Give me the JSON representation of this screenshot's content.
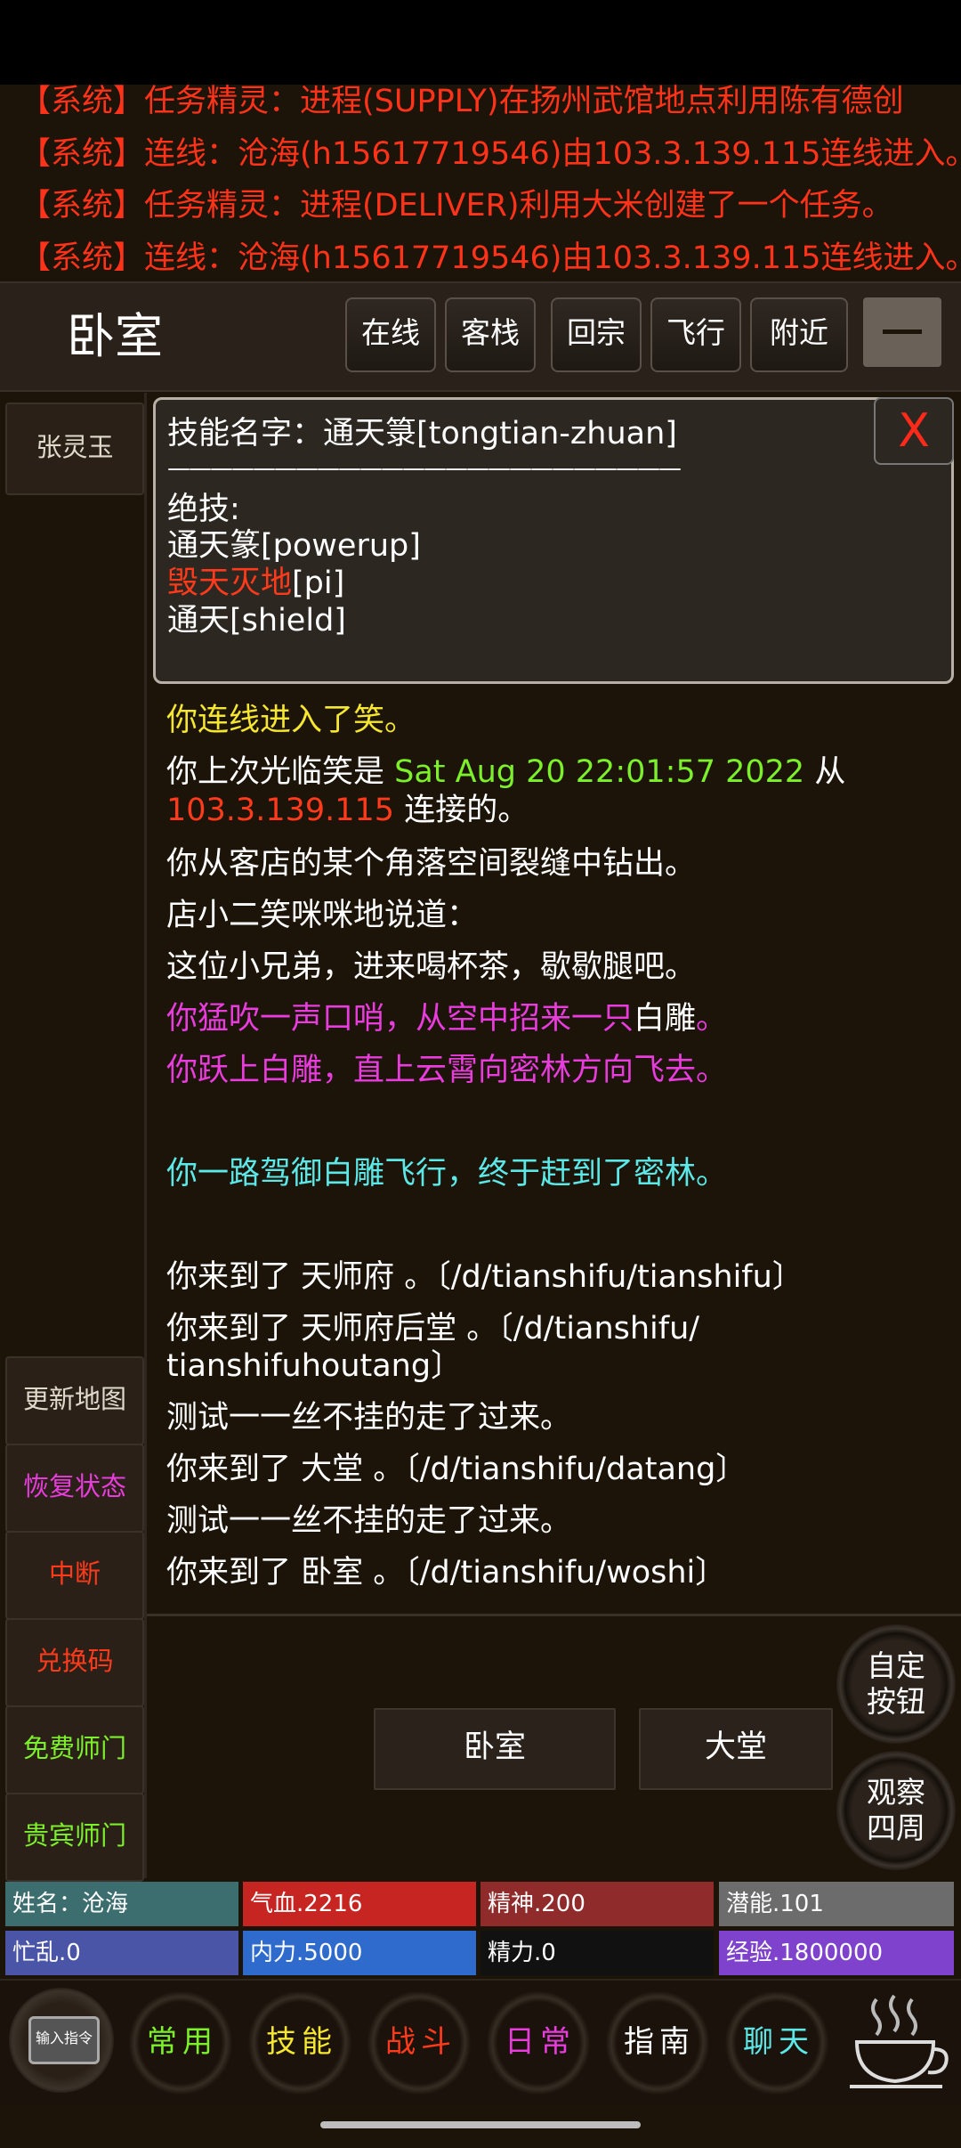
{
  "system_messages": [
    "【系统】任务精灵：进程(SUPPLY)在扬州武馆地点利用陈有德创",
    "【系统】连线：沧海(h15617719546)由103.3.139.115连线进入。",
    "【系统】任务精灵：进程(DELIVER)利用大米创建了一个任务。",
    "【系统】连线：沧海(h15617719546)由103.3.139.115连线进入。"
  ],
  "header": {
    "room_title": "卧室",
    "buttons": [
      "在线",
      "客栈",
      "回宗",
      "飞行",
      "附近"
    ]
  },
  "sidebar": {
    "character": "张灵玉",
    "buttons": [
      {
        "label": "更新地图",
        "color": "#e0dacb"
      },
      {
        "label": "恢复状态",
        "color": "#e83cdc"
      },
      {
        "label": "中断",
        "color": "#ff3b1c"
      },
      {
        "label": "兑换码",
        "color": "#ff3b1c"
      },
      {
        "label": "免费师门",
        "color": "#7cf02a"
      },
      {
        "label": "贵宾师门",
        "color": "#7cf02a"
      }
    ]
  },
  "popup": {
    "close": "X",
    "skill_name": "技能名字：通天箓[tongtian-zhuan]",
    "divider": "————————————————————————",
    "special_label": "绝技:",
    "skills": [
      {
        "name": "通天篆",
        "arg": "[powerup]",
        "color": "#ffffff"
      },
      {
        "name": "毁天灭地",
        "arg": "[pi]",
        "color": "#ff3b1c"
      },
      {
        "name": "通天",
        "arg": "[shield]",
        "color": "#ffffff"
      }
    ]
  },
  "messages": {
    "m1": "你连线进入了笑。",
    "m2a": "你上次光临笑是 ",
    "m2b": "Sat Aug 20 22:01:57 2022",
    "m2c": " 从",
    "m3a": "103.3.139.115",
    "m3b": " 连接的。",
    "m4": "你从客店的某个角落空间裂缝中钻出。",
    "m5": "店小二笑咪咪地说道：",
    "m6": "这位小兄弟，进来喝杯茶，歇歇腿吧。",
    "m7a": "你猛吹一声口哨，从空中招来一只",
    "m7b": "白雕",
    "m7c": "。",
    "m8": "你跃上白雕，直上云霄向密林方向飞去。",
    "m9": "你一路驾御白雕飞行，终于赶到了密林。",
    "m10": "你来到了 天师府 。〔/d/tianshifu/tianshifu〕",
    "m11a": "你来到了 天师府后堂 。〔/d/tianshifu/",
    "m11b": "tianshifuhoutang〕",
    "m12": "测试一一丝不挂的走了过来。",
    "m13": "你来到了 大堂 。〔/d/tianshifu/datang〕",
    "m14": "测试一一丝不挂的走了过来。",
    "m15": "你来到了 卧室 。〔/d/tianshifu/woshi〕"
  },
  "exits": [
    "卧室",
    "大堂"
  ],
  "round_buttons": [
    {
      "line1": "自定",
      "line2": "按钮"
    },
    {
      "line1": "观察",
      "line2": "四周"
    }
  ],
  "stats": [
    {
      "text": "姓名：沧海",
      "color": "#3d6e6f"
    },
    {
      "text": "气血.2216",
      "color": "#c62522"
    },
    {
      "text": "精神.200",
      "color": "#8f2b2b"
    },
    {
      "text": "潜能.101",
      "color": "#6c6c6c"
    },
    {
      "text": "忙乱.0",
      "color": "#4a55a8"
    },
    {
      "text": "内力.5000",
      "color": "#2f6bcc"
    },
    {
      "text": "精力.0",
      "color": "#111111"
    },
    {
      "text": "经验.1800000",
      "color": "#7e42cc"
    }
  ],
  "bottom_nav": {
    "input_label": "输入指令",
    "tabs": [
      {
        "label": "常用",
        "color": "#7cf02a"
      },
      {
        "label": "技能",
        "color": "#f5e631"
      },
      {
        "label": "战斗",
        "color": "#ff3b1c"
      },
      {
        "label": "日常",
        "color": "#e83cdc"
      },
      {
        "label": "指南",
        "color": "#ffffff"
      },
      {
        "label": "聊天",
        "color": "#5de8e8"
      }
    ],
    "tea_icon": "teacup-icon"
  }
}
